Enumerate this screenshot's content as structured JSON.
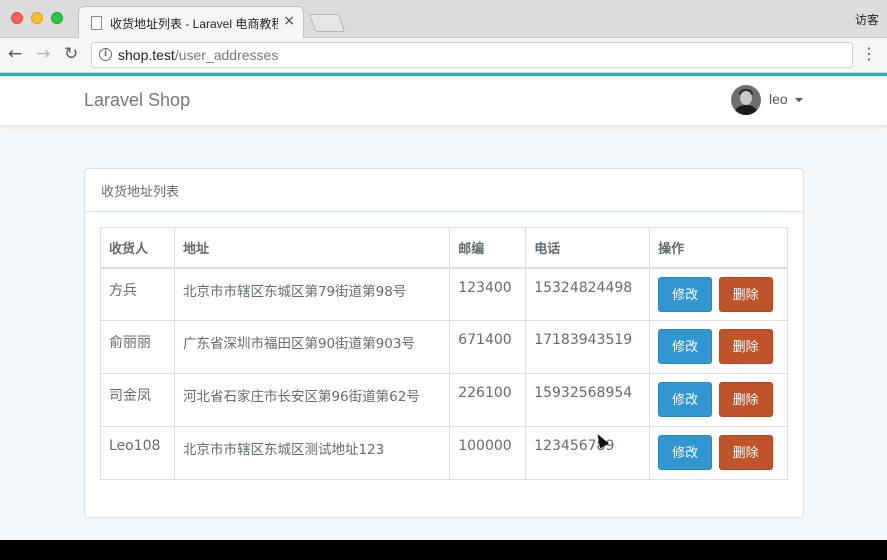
{
  "browser": {
    "tab_title": "收货地址列表 - Laravel 电商教程",
    "tab_close": "×",
    "guest_label": "访客",
    "url_host": "shop.test",
    "url_path": "/user_addresses",
    "back_icon": "←",
    "forward_icon": "→",
    "reload_icon": "↻",
    "menu_icon": "⋮",
    "info_icon": "i"
  },
  "navbar": {
    "brand": "Laravel Shop",
    "username": "leo"
  },
  "panel": {
    "title": "收货地址列表",
    "headers": [
      "收货人",
      "地址",
      "邮编",
      "电话",
      "操作"
    ],
    "rows": [
      {
        "name": "方兵",
        "address": "北京市市辖区东城区第79街道第98号",
        "zip": "123400",
        "phone": "15324824498",
        "edit": "修改",
        "delete": "删除"
      },
      {
        "name": "俞丽丽",
        "address": "广东省深圳市福田区第90街道第903号",
        "zip": "671400",
        "phone": "17183943519",
        "edit": "修改",
        "delete": "删除"
      },
      {
        "name": "司金凤",
        "address": "河北省石家庄市长安区第96街道第62号",
        "zip": "226100",
        "phone": "15932568954",
        "edit": "修改",
        "delete": "删除"
      },
      {
        "name": "Leo108",
        "address": "北京市市辖区东城区测试地址123",
        "zip": "100000",
        "phone": "123456789",
        "edit": "修改",
        "delete": "删除"
      }
    ]
  },
  "colors": {
    "accent": "#1ab6a8",
    "edit_button": "#3097d1",
    "delete_button": "#bf5329"
  }
}
